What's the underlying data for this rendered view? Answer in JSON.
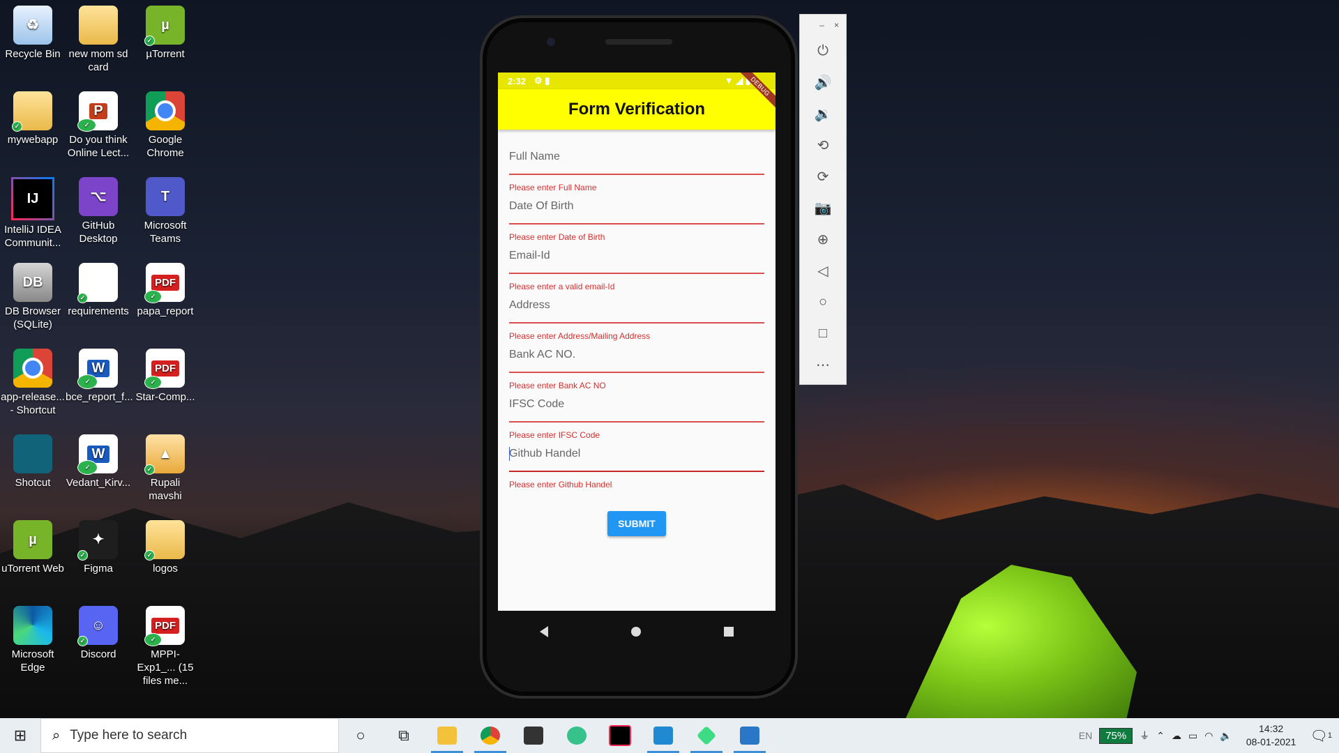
{
  "desktop": {
    "icons": [
      {
        "label": "Recycle Bin",
        "glyph": "♻"
      },
      {
        "label": "new mom sd card",
        "glyph": ""
      },
      {
        "label": "µTorrent",
        "glyph": "µ"
      },
      {
        "label": "mywebapp",
        "glyph": ""
      },
      {
        "label": "Do you think Online Lect...",
        "glyph": "P"
      },
      {
        "label": "Google Chrome",
        "glyph": ""
      },
      {
        "label": "IntelliJ IDEA Communit...",
        "glyph": "IJ"
      },
      {
        "label": "GitHub Desktop",
        "glyph": "⌥"
      },
      {
        "label": "Microsoft Teams",
        "glyph": "T"
      },
      {
        "label": "DB Browser (SQLite)",
        "glyph": "DB"
      },
      {
        "label": "requirements",
        "glyph": ""
      },
      {
        "label": "papa_report",
        "glyph": "PDF"
      },
      {
        "label": "app-release... - Shortcut",
        "glyph": ""
      },
      {
        "label": "bce_report_f...",
        "glyph": "W"
      },
      {
        "label": "Star-Comp...",
        "glyph": "PDF"
      },
      {
        "label": "Shotcut",
        "glyph": ""
      },
      {
        "label": "Vedant_Kirv...",
        "glyph": "W"
      },
      {
        "label": "Rupali mavshi",
        "glyph": "▲"
      },
      {
        "label": "uTorrent Web",
        "glyph": "µ"
      },
      {
        "label": "Figma",
        "glyph": "✦"
      },
      {
        "label": "logos",
        "glyph": ""
      },
      {
        "label": "Microsoft Edge",
        "glyph": ""
      },
      {
        "label": "Discord",
        "glyph": "☺"
      },
      {
        "label": "MPPI-Exp1_... (15 files me...",
        "glyph": "PDF"
      }
    ]
  },
  "phone": {
    "status": {
      "time": "2:32",
      "icons_left": "⚙ ▮",
      "icons_right": "▼ ◢ ▮"
    },
    "debug_banner": "DEBUG",
    "app_title": "Form Verification",
    "fields": [
      {
        "label": "Full Name",
        "error": "Please enter Full Name"
      },
      {
        "label": "Date Of Birth",
        "error": "Please enter Date of Birth"
      },
      {
        "label": "Email-Id",
        "error": "Please enter a valid email-Id"
      },
      {
        "label": "Address",
        "error": "Please enter Address/Mailing Address"
      },
      {
        "label": "Bank AC NO.",
        "error": "Please enter Bank AC NO"
      },
      {
        "label": "IFSC Code",
        "error": "Please enter IFSC Code"
      },
      {
        "label": "Github Handel",
        "error": "Please enter Github Handel"
      }
    ],
    "submit_label": "SUBMIT"
  },
  "emulator_toolbar": {
    "minimize": "–",
    "close": "×",
    "buttons": [
      {
        "name": "power-icon",
        "glyph": "⏻"
      },
      {
        "name": "volume-up-icon",
        "glyph": "🔊"
      },
      {
        "name": "volume-down-icon",
        "glyph": "🔉"
      },
      {
        "name": "rotate-left-icon",
        "glyph": "⟲"
      },
      {
        "name": "rotate-right-icon",
        "glyph": "⟳"
      },
      {
        "name": "camera-icon",
        "glyph": "📷"
      },
      {
        "name": "zoom-icon",
        "glyph": "⊕"
      },
      {
        "name": "back-icon",
        "glyph": "◁"
      },
      {
        "name": "home-icon",
        "glyph": "○"
      },
      {
        "name": "overview-icon",
        "glyph": "□"
      },
      {
        "name": "more-icon",
        "glyph": "⋯"
      }
    ]
  },
  "taskbar": {
    "search_placeholder": "Type here to search",
    "language": "EN",
    "battery": "75%",
    "time": "14:32",
    "date": "08-01-2021",
    "notification_count": "1"
  },
  "colors": {
    "appbar": "#ffff00",
    "error": "#d32f2f",
    "submit": "#2196f3",
    "taskbar_accent": "#3a8fd8"
  }
}
